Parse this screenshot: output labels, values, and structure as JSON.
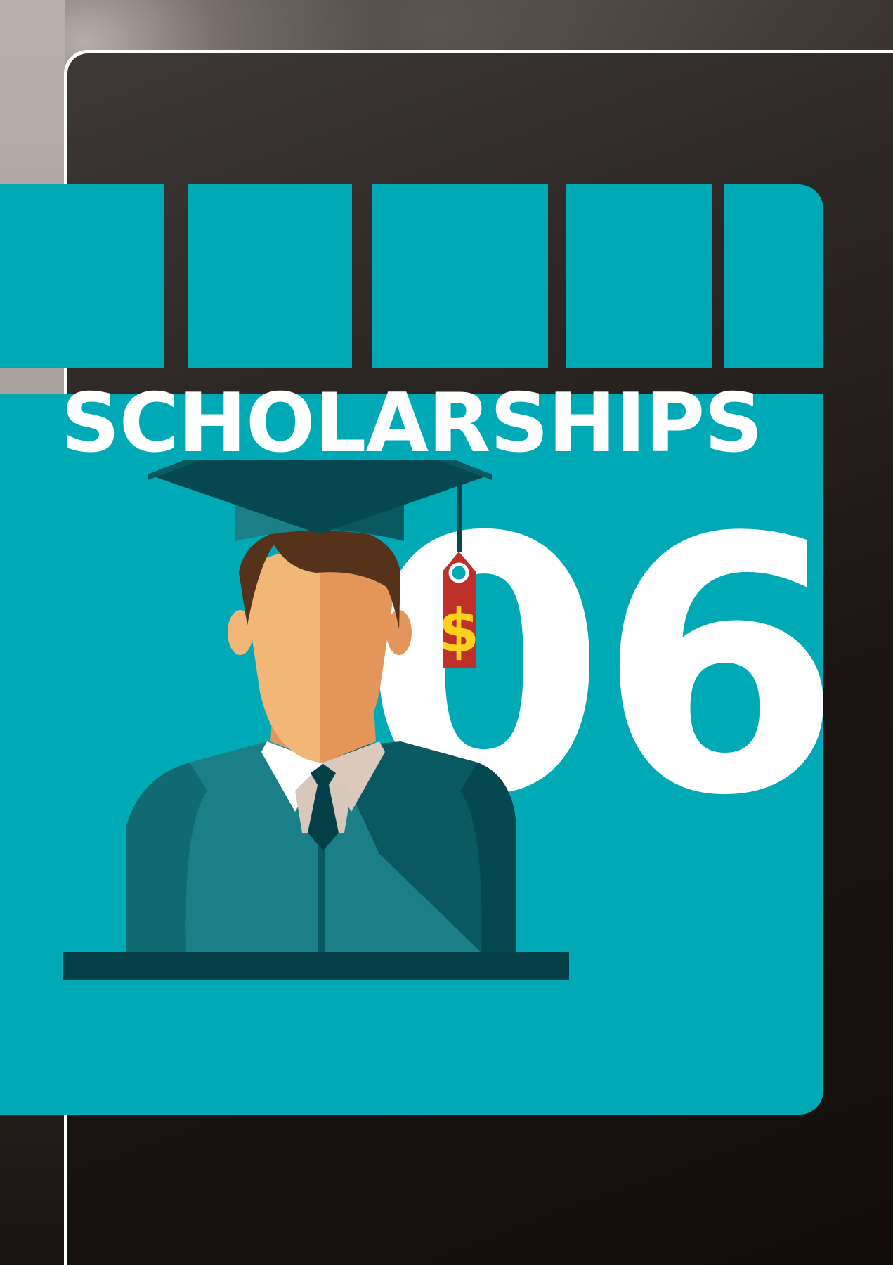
{
  "heading": "SCHOLARSHIPS",
  "number": "06",
  "colors": {
    "accent": "#00a9b6",
    "dark_teal": "#053f47",
    "mid_teal": "#1a7f87",
    "skin": "#f2b777",
    "hair": "#56321b",
    "tag": "#c0302b",
    "dollar": "#ffd21f"
  },
  "icons": {
    "graduate": "graduate-student-icon",
    "price_tag": "price-tag-icon",
    "dollar": "dollar-sign-icon"
  },
  "tag_symbol": "$"
}
